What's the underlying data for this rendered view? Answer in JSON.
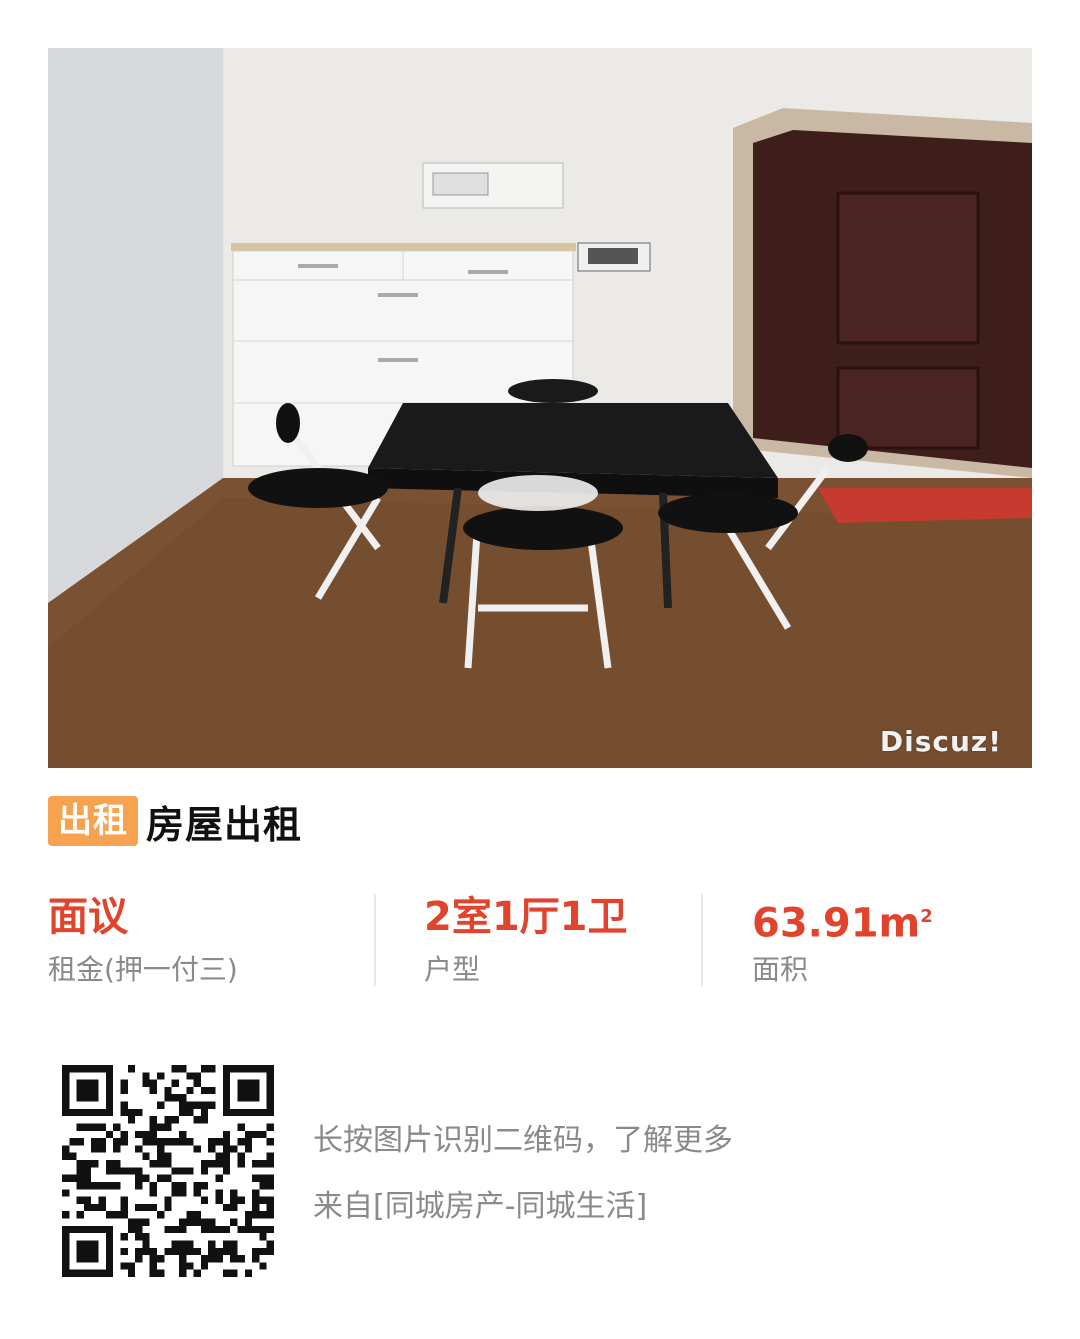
{
  "photo": {
    "watermark": "Discuz!"
  },
  "listing": {
    "tag": "出租",
    "title": "房屋出租"
  },
  "stats": [
    {
      "value": "面议",
      "label": "租金(押一付三)"
    },
    {
      "value": "2室1厅1卫",
      "label": "户型"
    },
    {
      "value": "63.91m",
      "value_sup": "2",
      "label": "面积"
    }
  ],
  "footer": {
    "hint": "长按图片识别二维码，了解更多",
    "source": "来自[同城房产-同城生活]"
  },
  "colors": {
    "accent": "#e0442d",
    "tag_bg": "#f6a24f",
    "muted_text": "#8a8a8a"
  }
}
